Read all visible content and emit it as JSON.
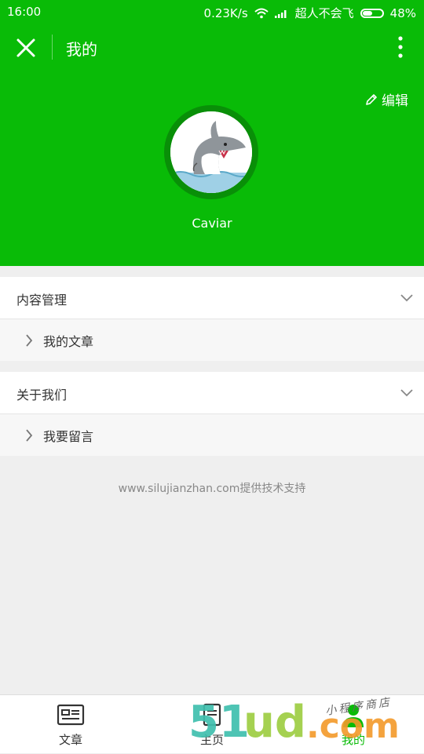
{
  "status_bar": {
    "time": "16:00",
    "network_speed": "0.23K/s",
    "carrier": "超人不会飞",
    "battery": "48%",
    "battery_level": 0.48
  },
  "title_bar": {
    "title": "我的",
    "close_icon": "close-icon",
    "more_icon": "more-vertical-icon"
  },
  "profile": {
    "edit_label": "编辑",
    "username": "Caviar",
    "avatar_icon": "shark-avatar"
  },
  "sections": [
    {
      "title": "内容管理",
      "items": [
        {
          "label": "我的文章"
        }
      ]
    },
    {
      "title": "关于我们",
      "items": [
        {
          "label": "我要留言"
        }
      ]
    }
  ],
  "footer": {
    "support_text": "www.silujianzhan.com提供技术支持"
  },
  "tabbar": {
    "tabs": [
      {
        "label": "文章",
        "icon": "article-icon",
        "active": false
      },
      {
        "label": "主页",
        "icon": "home-icon",
        "active": false
      },
      {
        "label": "我的",
        "icon": "user-icon",
        "active": true
      }
    ]
  },
  "watermark": {
    "text": "51ud.com",
    "subtext": "小程序商店"
  },
  "colors": {
    "primary": "#09bb07",
    "background": "#efefef",
    "active_tab": "#09bb07"
  }
}
